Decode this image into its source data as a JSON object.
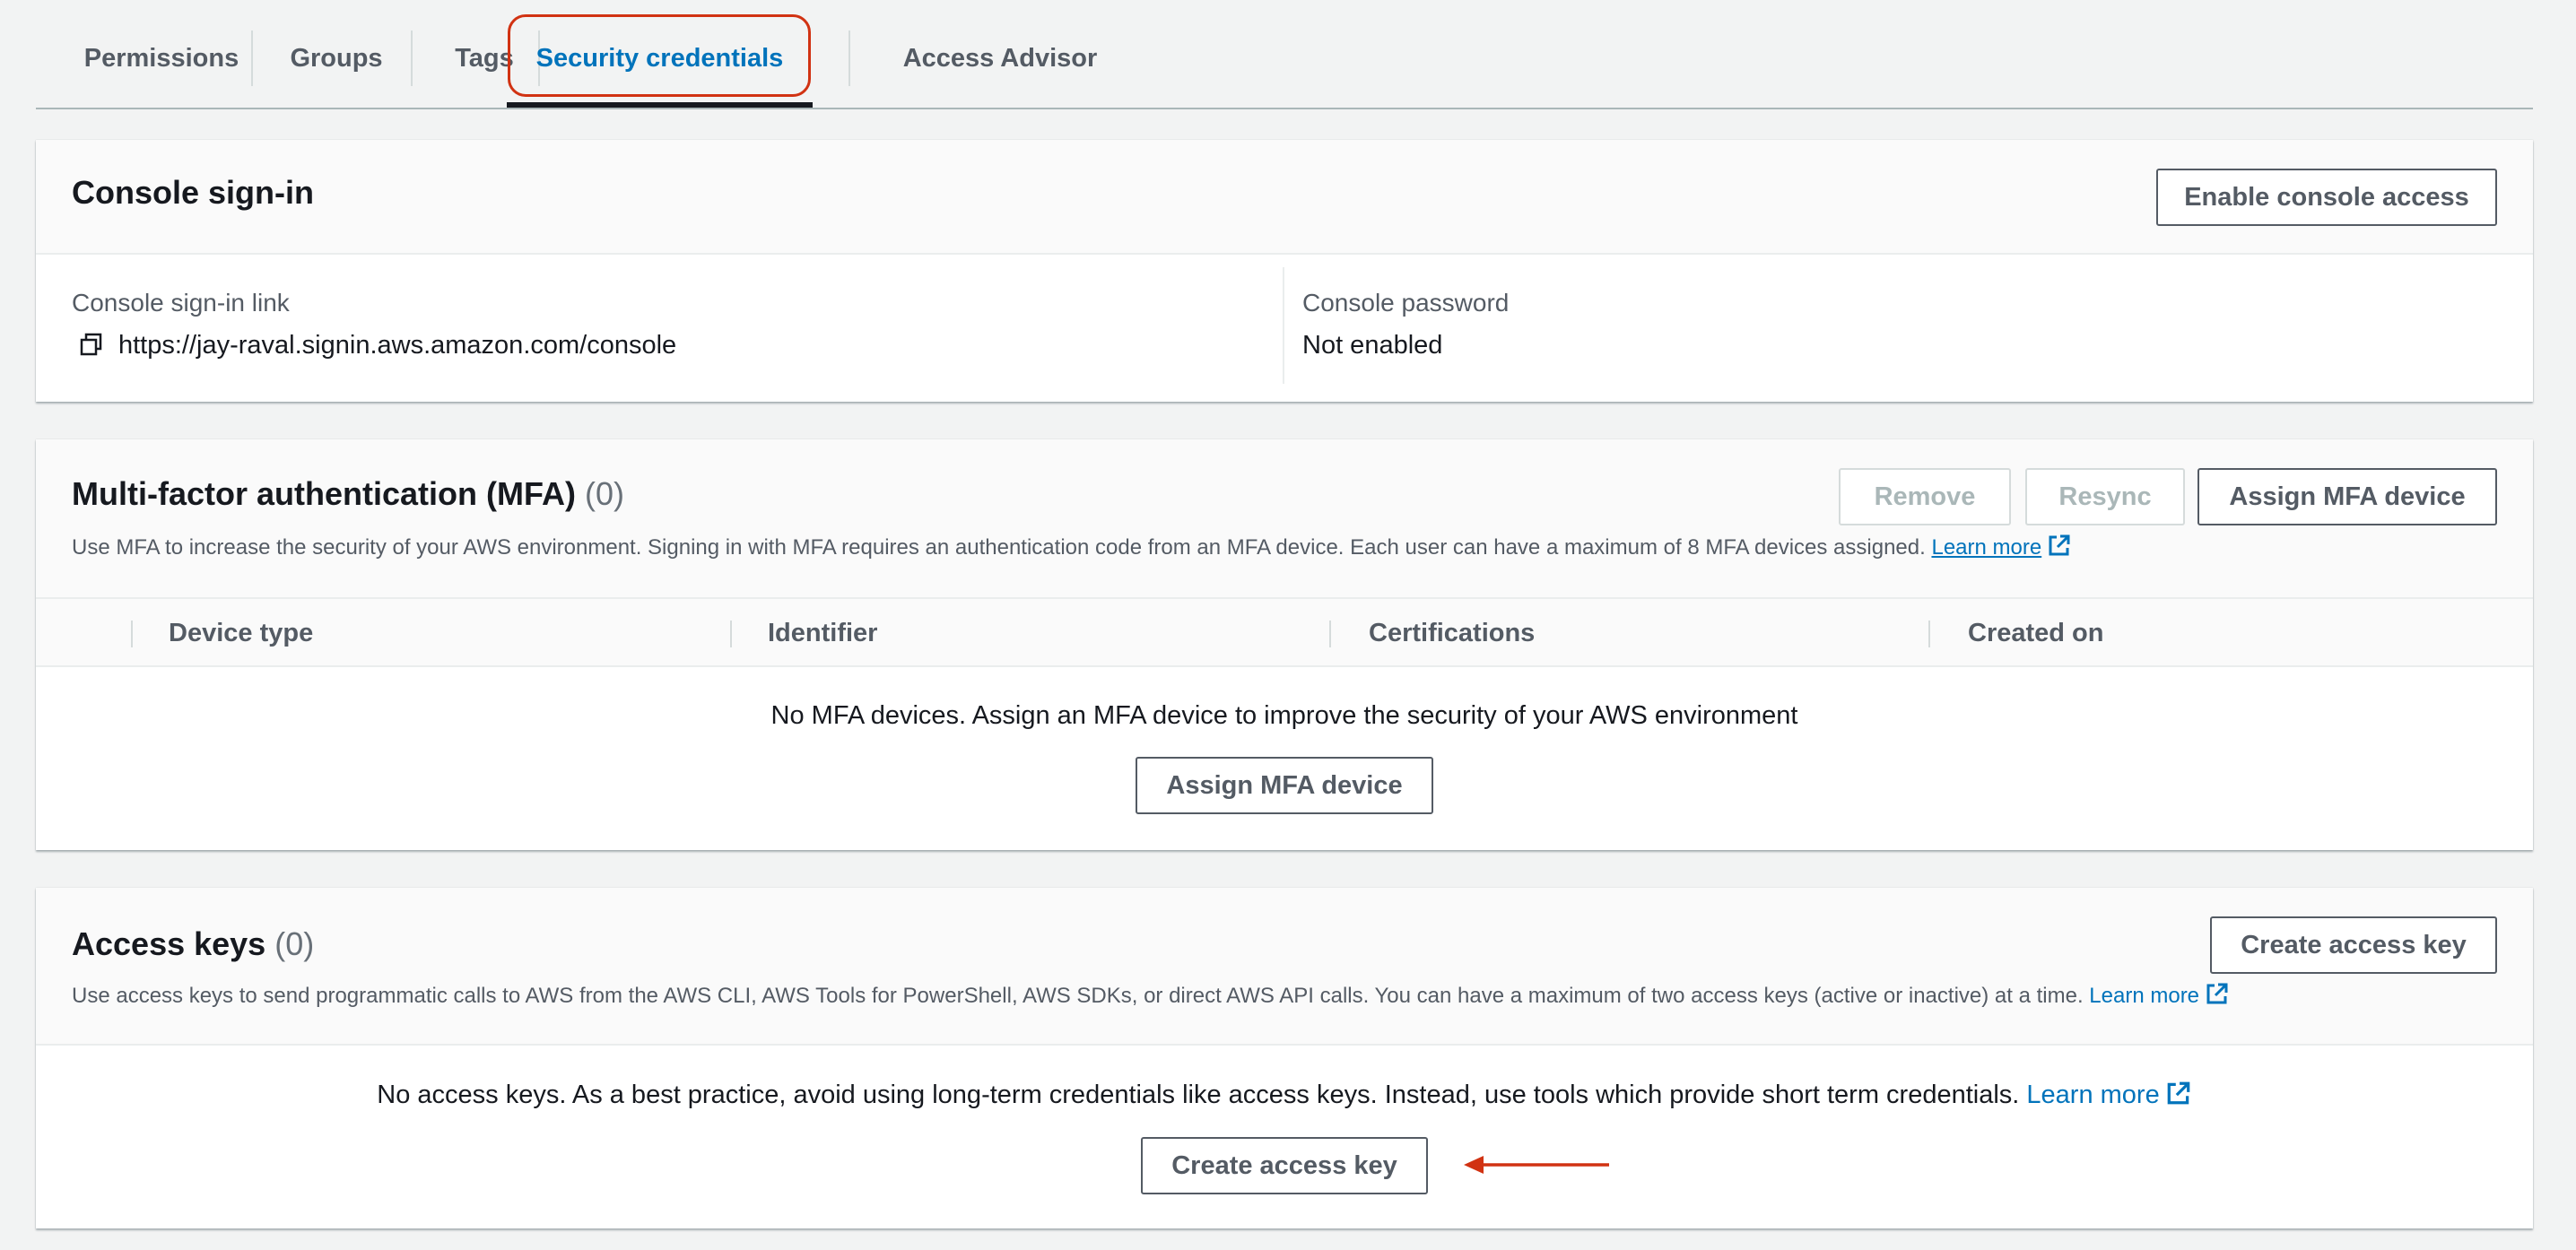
{
  "tabs": {
    "items": [
      {
        "label": "Permissions"
      },
      {
        "label": "Groups"
      },
      {
        "label": "Tags"
      },
      {
        "label": "Security credentials"
      },
      {
        "label": "Access Advisor"
      }
    ],
    "active": "Security credentials"
  },
  "console_signin": {
    "title": "Console sign-in",
    "enable_button": "Enable console access",
    "link_label": "Console sign-in link",
    "link_value": "https://jay-raval.signin.aws.amazon.com/console",
    "password_label": "Console password",
    "password_value": "Not enabled"
  },
  "mfa": {
    "title": "Multi-factor authentication (MFA)",
    "count": "(0)",
    "remove_button": "Remove",
    "resync_button": "Resync",
    "assign_button": "Assign MFA device",
    "description": "Use MFA to increase the security of your AWS environment. Signing in with MFA requires an authentication code from an MFA device. Each user can have a maximum of 8 MFA devices assigned.",
    "learn_more": "Learn more",
    "columns": [
      "Device type",
      "Identifier",
      "Certifications",
      "Created on"
    ],
    "empty_text": "No MFA devices. Assign an MFA device to improve the security of your AWS environment",
    "empty_assign_button": "Assign MFA device"
  },
  "access_keys": {
    "title": "Access keys",
    "count": "(0)",
    "create_button": "Create access key",
    "description": "Use access keys to send programmatic calls to AWS from the AWS CLI, AWS Tools for PowerShell, AWS SDKs, or direct AWS API calls. You can have a maximum of two access keys (active or inactive) at a time.",
    "learn_more": "Learn more",
    "empty_text": "No access keys. As a best practice, avoid using long-term credentials like access keys. Instead, use tools which provide short term credentials.",
    "empty_learn_more": "Learn more",
    "empty_create_button": "Create access key"
  },
  "colors": {
    "link": "#0073bb",
    "annotation": "#d13212",
    "text": "#16191f",
    "muted": "#545b64"
  },
  "icons": {
    "copy": "copy-icon",
    "external": "external-link-icon",
    "arrow": "annotation-arrow-icon"
  }
}
